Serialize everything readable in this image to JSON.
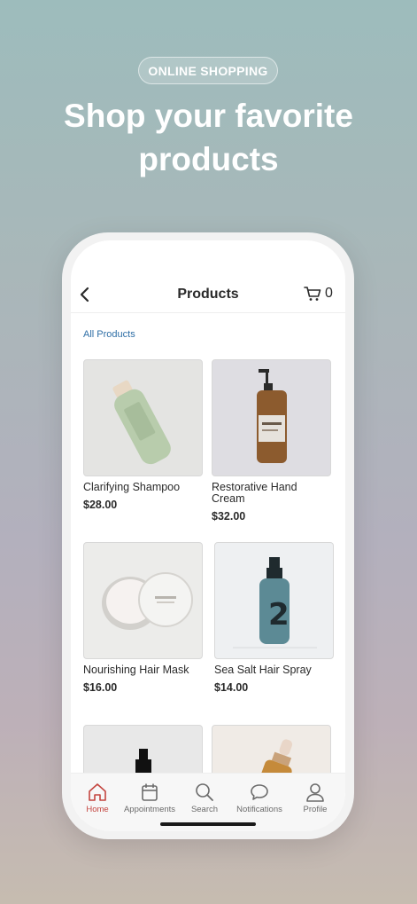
{
  "hero": {
    "badge": "ONLINE SHOPPING",
    "title_line1": "Shop your favorite",
    "title_line2": "products"
  },
  "nav": {
    "title": "Products",
    "cart_count": "0"
  },
  "breadcrumb": "All Products",
  "products": [
    {
      "name": "Clarifying Shampoo",
      "price": "$28.00"
    },
    {
      "name": "Restorative Hand Cream",
      "price": "$32.00"
    },
    {
      "name": "Nourishing Hair Mask",
      "price": "$16.00"
    },
    {
      "name": "Sea Salt Hair Spray",
      "price": "$14.00"
    },
    {
      "name": "",
      "price": ""
    },
    {
      "name": "",
      "price": ""
    }
  ],
  "tabs": [
    {
      "label": "Home",
      "icon": "home-icon",
      "active": true
    },
    {
      "label": "Appointments",
      "icon": "calendar-icon",
      "active": false
    },
    {
      "label": "Search",
      "icon": "search-icon",
      "active": false
    },
    {
      "label": "Notifications",
      "icon": "chat-bubble-icon",
      "active": false
    },
    {
      "label": "Profile",
      "icon": "person-icon",
      "active": false
    }
  ],
  "colors": {
    "accent": "#c4453f",
    "link": "#2f6fa6"
  }
}
